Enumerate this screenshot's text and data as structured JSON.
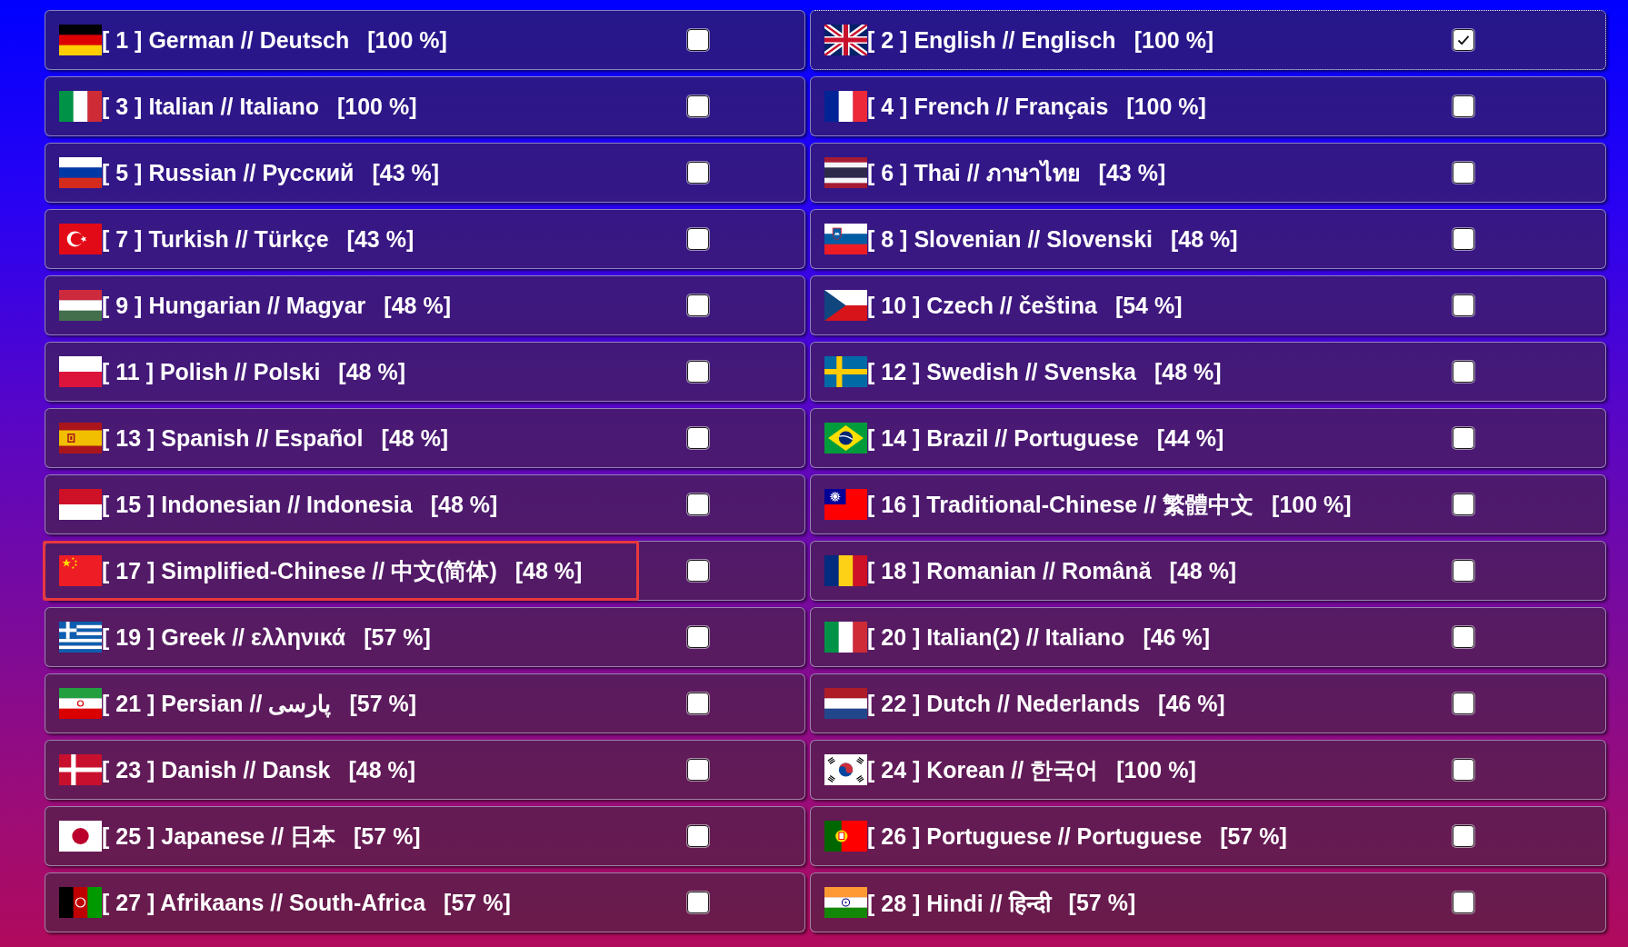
{
  "languages": [
    {
      "label": "[ 1 ] German // Deutsch",
      "percent": "[100 %]",
      "kind": "germany",
      "checked": false,
      "focused": false,
      "marked": false
    },
    {
      "label": "[ 2 ] English // Englisch",
      "percent": "[100 %]",
      "kind": "britain",
      "checked": true,
      "focused": true,
      "marked": false
    },
    {
      "label": "[ 3 ] Italian // Italiano",
      "percent": "[100 %]",
      "kind": "italy",
      "checked": false,
      "focused": false,
      "marked": false
    },
    {
      "label": "[ 4 ] French // Français",
      "percent": "[100 %]",
      "kind": "france",
      "checked": false,
      "focused": false,
      "marked": false
    },
    {
      "label": "[ 5 ] Russian // Русский",
      "percent": "[43 %]",
      "kind": "russia",
      "checked": false,
      "focused": false,
      "marked": false
    },
    {
      "label": "[ 6 ] Thai // ภาษาไทย",
      "percent": "[43 %]",
      "kind": "thailand",
      "checked": false,
      "focused": false,
      "marked": false
    },
    {
      "label": "[ 7 ] Turkish // Türkçe",
      "percent": "[43 %]",
      "kind": "turkey",
      "checked": false,
      "focused": false,
      "marked": false
    },
    {
      "label": "[ 8 ] Slovenian // Slovenski",
      "percent": "[48 %]",
      "kind": "slovenia",
      "checked": false,
      "focused": false,
      "marked": false
    },
    {
      "label": "[ 9 ] Hungarian // Magyar",
      "percent": "[48 %]",
      "kind": "hungary",
      "checked": false,
      "focused": false,
      "marked": false
    },
    {
      "label": "[ 10 ] Czech // čeština",
      "percent": "[54 %]",
      "kind": "czechia",
      "checked": false,
      "focused": false,
      "marked": false
    },
    {
      "label": "[ 11 ] Polish // Polski",
      "percent": "[48 %]",
      "kind": "poland",
      "checked": false,
      "focused": false,
      "marked": false
    },
    {
      "label": "[ 12 ] Swedish // Svenska",
      "percent": "[48 %]",
      "kind": "sweden",
      "checked": false,
      "focused": false,
      "marked": false
    },
    {
      "label": "[ 13 ] Spanish // Español",
      "percent": "[48 %]",
      "kind": "spain",
      "checked": false,
      "focused": false,
      "marked": false
    },
    {
      "label": "[ 14 ] Brazil // Portuguese",
      "percent": "[44 %]",
      "kind": "brazil",
      "checked": false,
      "focused": false,
      "marked": false
    },
    {
      "label": "[ 15 ] Indonesian // Indonesia",
      "percent": "[48 %]",
      "kind": "indonesia",
      "checked": false,
      "focused": false,
      "marked": false
    },
    {
      "label": "[ 16 ] Traditional-Chinese // 繁體中文",
      "percent": "[100 %]",
      "kind": "taiwan",
      "checked": false,
      "focused": false,
      "marked": false
    },
    {
      "label": "[ 17 ] Simplified-Chinese // 中文(简体)",
      "percent": "[48 %]",
      "kind": "china",
      "checked": false,
      "focused": false,
      "marked": true
    },
    {
      "label": "[ 18 ] Romanian // Română",
      "percent": "[48 %]",
      "kind": "romania",
      "checked": false,
      "focused": false,
      "marked": false
    },
    {
      "label": "[ 19 ] Greek // ελληνικά",
      "percent": "[57 %]",
      "kind": "greece",
      "checked": false,
      "focused": false,
      "marked": false
    },
    {
      "label": "[ 20 ] Italian(2) // Italiano",
      "percent": "[46 %]",
      "kind": "italy",
      "checked": false,
      "focused": false,
      "marked": false
    },
    {
      "label": "[ 21 ] Persian // پارسی",
      "percent": "[57 %]",
      "kind": "iran",
      "checked": false,
      "focused": false,
      "marked": false
    },
    {
      "label": "[ 22 ] Dutch // Nederlands",
      "percent": "[46 %]",
      "kind": "netherlands",
      "checked": false,
      "focused": false,
      "marked": false
    },
    {
      "label": "[ 23 ] Danish // Dansk",
      "percent": "[48 %]",
      "kind": "denmark",
      "checked": false,
      "focused": false,
      "marked": false
    },
    {
      "label": "[ 24 ] Korean // 한국어",
      "percent": "[100 %]",
      "kind": "korea",
      "checked": false,
      "focused": false,
      "marked": false
    },
    {
      "label": "[ 25 ] Japanese // 日本",
      "percent": "[57 %]",
      "kind": "japan",
      "checked": false,
      "focused": false,
      "marked": false
    },
    {
      "label": "[ 26 ] Portuguese // Portuguese",
      "percent": "[57 %]",
      "kind": "portugal",
      "checked": false,
      "focused": false,
      "marked": false
    },
    {
      "label": "[ 27 ] Afrikaans // South-Africa",
      "percent": "[57 %]",
      "kind": "afghanistan",
      "checked": false,
      "focused": false,
      "marked": false
    },
    {
      "label": "[ 28 ] Hindi // हिन्दी",
      "percent": "[57 %]",
      "kind": "india",
      "checked": false,
      "focused": false,
      "marked": false
    }
  ]
}
